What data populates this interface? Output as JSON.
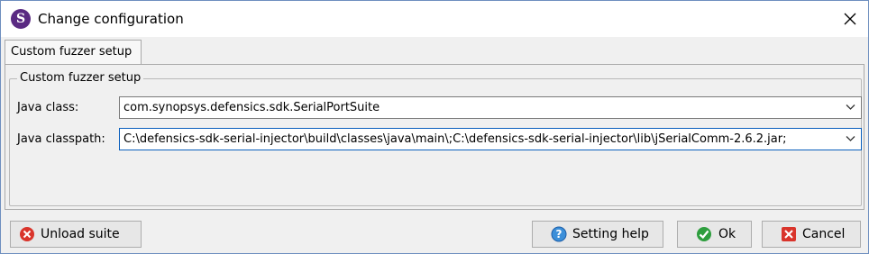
{
  "window": {
    "title": "Change configuration",
    "app_icon_letter": "S"
  },
  "tabs": [
    {
      "label": "Custom fuzzer setup",
      "selected": true
    }
  ],
  "group": {
    "title": "Custom fuzzer setup",
    "java_class": {
      "label": "Java class:",
      "value": "com.synopsys.defensics.sdk.SerialPortSuite"
    },
    "java_classpath": {
      "label": "Java classpath:",
      "value": "C:\\defensics-sdk-serial-injector\\build\\classes\\java\\main\\;C:\\defensics-sdk-serial-injector\\lib\\jSerialComm-2.6.2.jar;"
    }
  },
  "buttons": {
    "unload_suite": "Unload suite",
    "setting_help": "Setting help",
    "ok": "Ok",
    "cancel": "Cancel"
  },
  "icons": {
    "app": "synopsys-logo-icon",
    "close": "close-icon",
    "unload": "red-x-circle-icon",
    "help": "help-question-icon",
    "ok": "green-check-icon",
    "cancel": "red-x-square-icon"
  },
  "colors": {
    "app_icon": "#5a2a82",
    "focus_border": "#0a5fbd"
  }
}
